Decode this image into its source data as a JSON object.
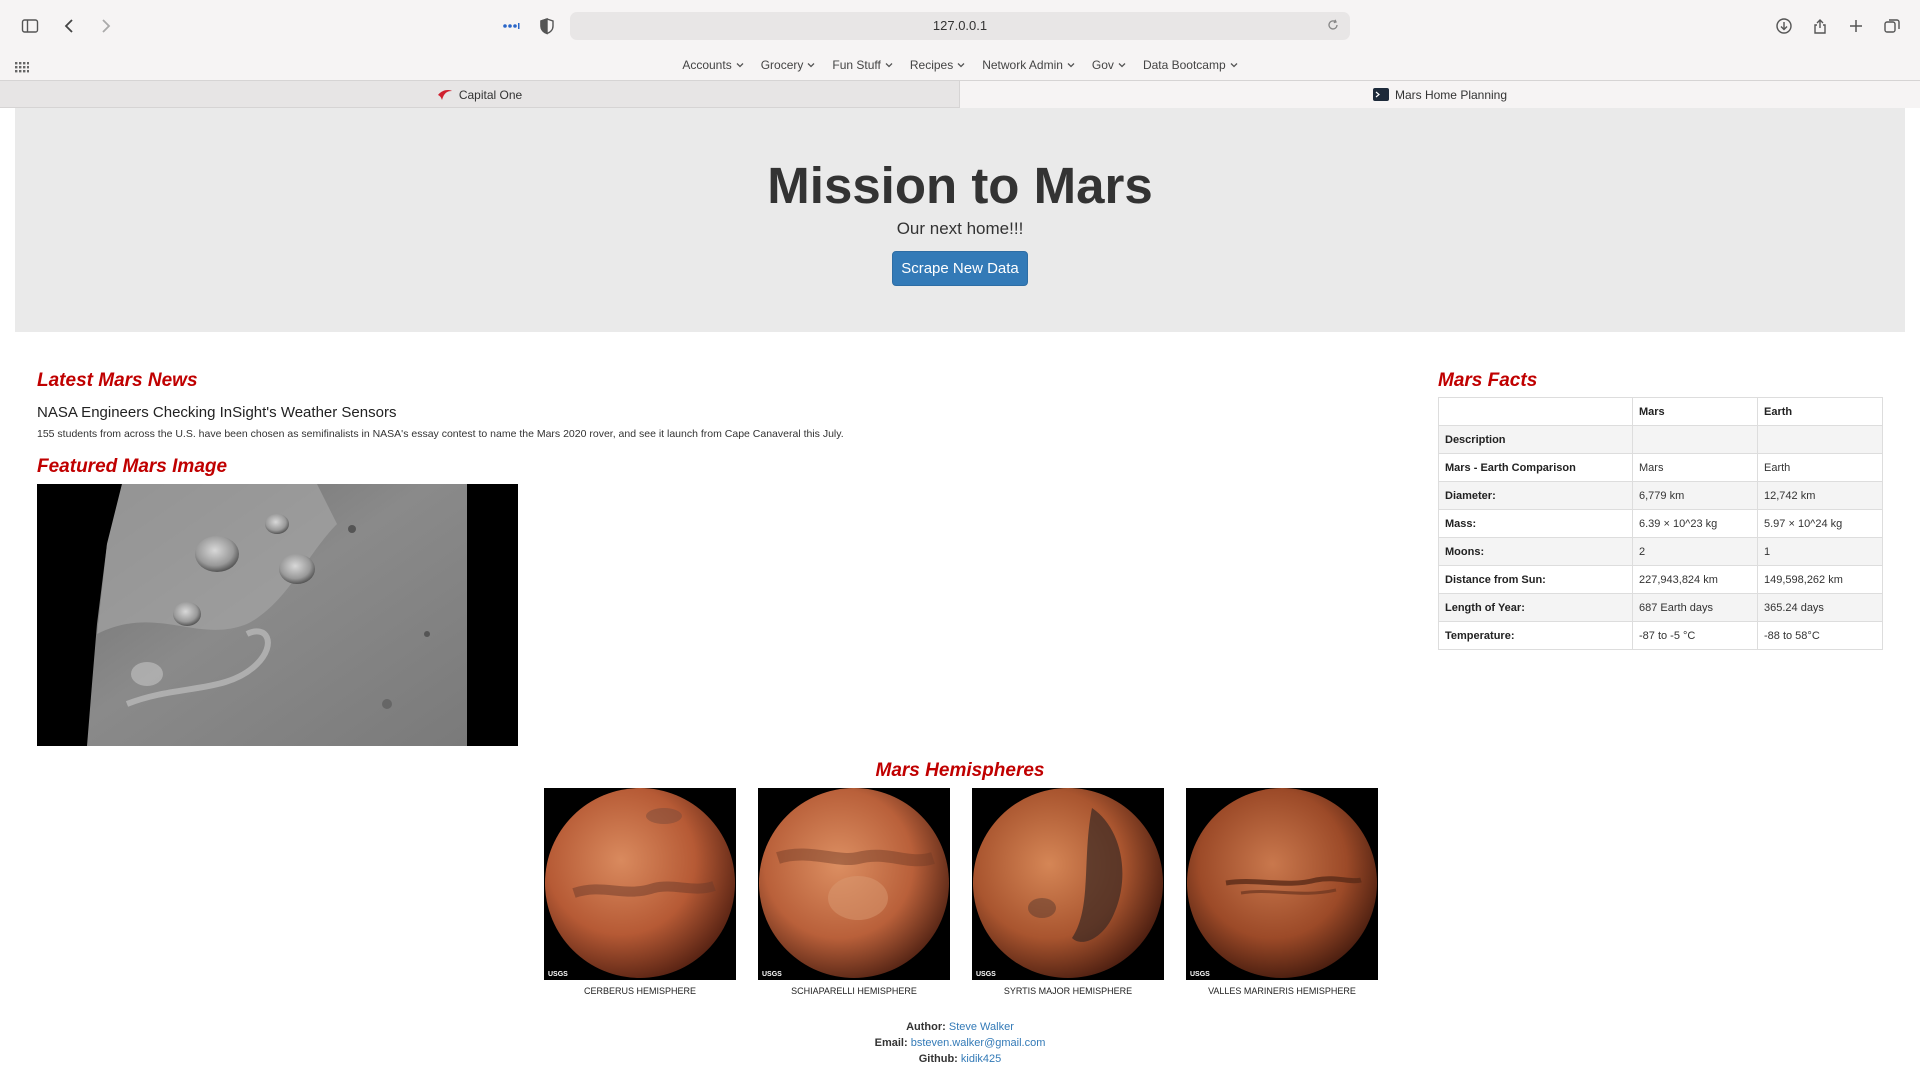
{
  "browser": {
    "url": "127.0.0.1",
    "favorites": [
      {
        "label": "Accounts"
      },
      {
        "label": "Grocery"
      },
      {
        "label": "Fun Stuff"
      },
      {
        "label": "Recipes"
      },
      {
        "label": "Network Admin"
      },
      {
        "label": "Gov"
      },
      {
        "label": "Data Bootcamp"
      }
    ],
    "tabs": [
      {
        "label": "Capital One",
        "icon": "capital-one-logo-icon"
      },
      {
        "label": "Mars Home Planning",
        "icon": "terminal-icon"
      }
    ]
  },
  "jumbotron": {
    "title": "Mission to Mars",
    "subtitle": "Our next home!!!",
    "button_label": "Scrape New Data"
  },
  "news": {
    "heading": "Latest Mars News",
    "title": "NASA Engineers Checking InSight's Weather Sensors",
    "body": "155 students from across the U.S. have been chosen as semifinalists in NASA's essay contest to name the Mars 2020 rover, and see it launch from Cape Canaveral this July."
  },
  "featured": {
    "heading": "Featured Mars Image"
  },
  "facts": {
    "heading": "Mars Facts",
    "columns": [
      "",
      "Mars",
      "Earth"
    ],
    "rows": [
      [
        "Description",
        "",
        ""
      ],
      [
        "Mars - Earth Comparison",
        "Mars",
        "Earth"
      ],
      [
        "Diameter:",
        "6,779 km",
        "12,742 km"
      ],
      [
        "Mass:",
        "6.39 × 10^23 kg",
        "5.97 × 10^24 kg"
      ],
      [
        "Moons:",
        "2",
        "1"
      ],
      [
        "Distance from Sun:",
        "227,943,824 km",
        "149,598,262 km"
      ],
      [
        "Length of Year:",
        "687 Earth days",
        "365.24 days"
      ],
      [
        "Temperature:",
        "-87 to -5 °C",
        "-88 to 58°C"
      ]
    ]
  },
  "hemispheres": {
    "heading": "Mars Hemispheres",
    "items": [
      {
        "title": "CERBERUS HEMISPHERE",
        "image_label": "USGS"
      },
      {
        "title": "SCHIAPARELLI HEMISPHERE",
        "image_label": "USGS"
      },
      {
        "title": "SYRTIS MAJOR HEMISPHERE",
        "image_label": "USGS"
      },
      {
        "title": "VALLES MARINERIS HEMISPHERE",
        "image_label": "USGS"
      }
    ]
  },
  "footer": {
    "author_label": "Author:",
    "author": "Steve Walker",
    "email_label": "Email:",
    "email": "bsteven.walker@gmail.com",
    "github_label": "Github:",
    "github": "kidik425"
  }
}
